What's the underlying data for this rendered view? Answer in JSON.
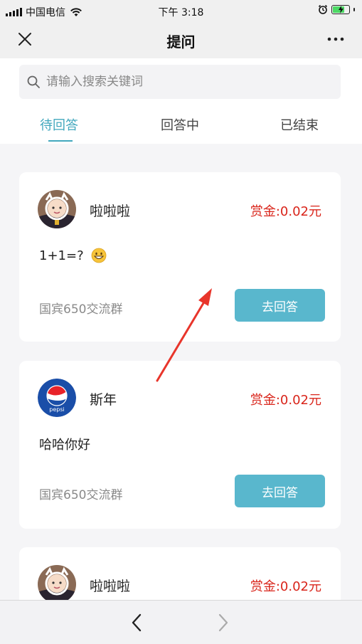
{
  "status_bar": {
    "carrier": "中国电信",
    "time": "下午 3:18"
  },
  "nav": {
    "title": "提问"
  },
  "search": {
    "placeholder": "请输入搜索关键词",
    "value": ""
  },
  "tabs": [
    {
      "label": "待回答",
      "active": true
    },
    {
      "label": "回答中",
      "active": false
    },
    {
      "label": "已结束",
      "active": false
    }
  ],
  "colors": {
    "accent": "#41a7bd",
    "button": "#59b7cd",
    "reward": "#d9251b",
    "annotation_arrow": "#e8352b"
  },
  "questions": [
    {
      "user": "啦啦啦",
      "avatar": "baby-photo-avatar",
      "reward": "赏金:0.02元",
      "text": "1+1=?",
      "emoji": "grinning-face",
      "group": "国宾650交流群",
      "button": "去回答"
    },
    {
      "user": "斯年",
      "avatar": "pepsi-logo-avatar",
      "reward": "赏金:0.02元",
      "text": "哈哈你好",
      "group": "国宾650交流群",
      "button": "去回答"
    },
    {
      "user": "啦啦啦",
      "avatar": "baby-photo-avatar",
      "reward": "赏金:0.02元"
    }
  ],
  "pepsi_avatar_text": "pepsi",
  "icons": {
    "close": "close-icon",
    "more": "more-icon",
    "search": "search-icon",
    "back": "chevron-left-icon",
    "forward": "chevron-right-icon"
  }
}
